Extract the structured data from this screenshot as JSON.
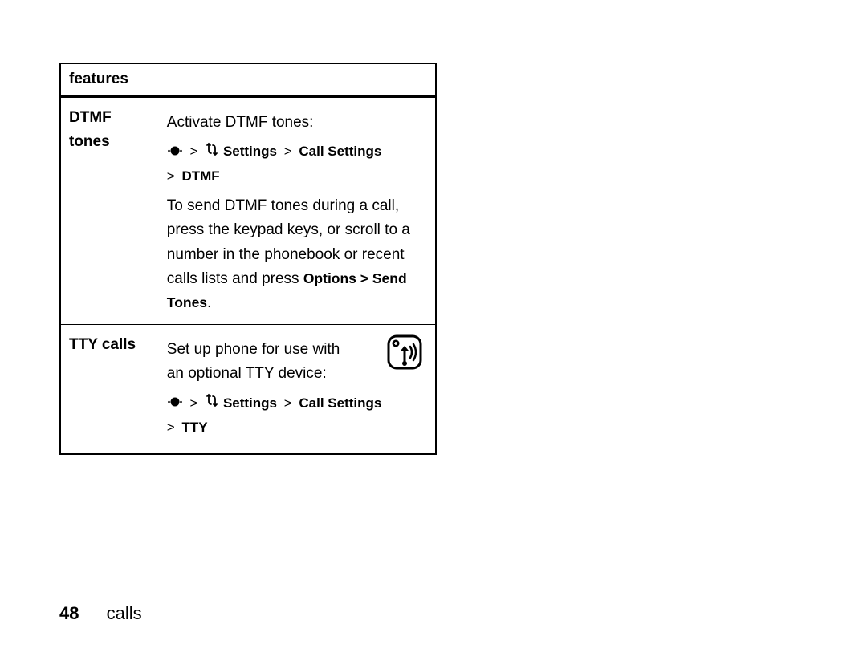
{
  "table": {
    "header": "features",
    "rows": [
      {
        "label": "DTMF tones",
        "intro": "Activate DTMF tones:",
        "nav1": "Settings",
        "nav2": "Call Settings",
        "nav3": "DTMF",
        "body_pre": "To send DTMF tones during a call, press the keypad keys, or scroll to a number in the phonebook or recent calls lists and press ",
        "body_bold": "Options > Send Tones",
        "body_post": "."
      },
      {
        "label": "TTY calls",
        "intro": "Set up phone for use with an optional TTY device:",
        "nav1": "Settings",
        "nav2": "Call Settings",
        "nav3": "TTY"
      }
    ]
  },
  "footer": {
    "page": "48",
    "section": "calls"
  },
  "glyphs": {
    "gt": ">"
  }
}
